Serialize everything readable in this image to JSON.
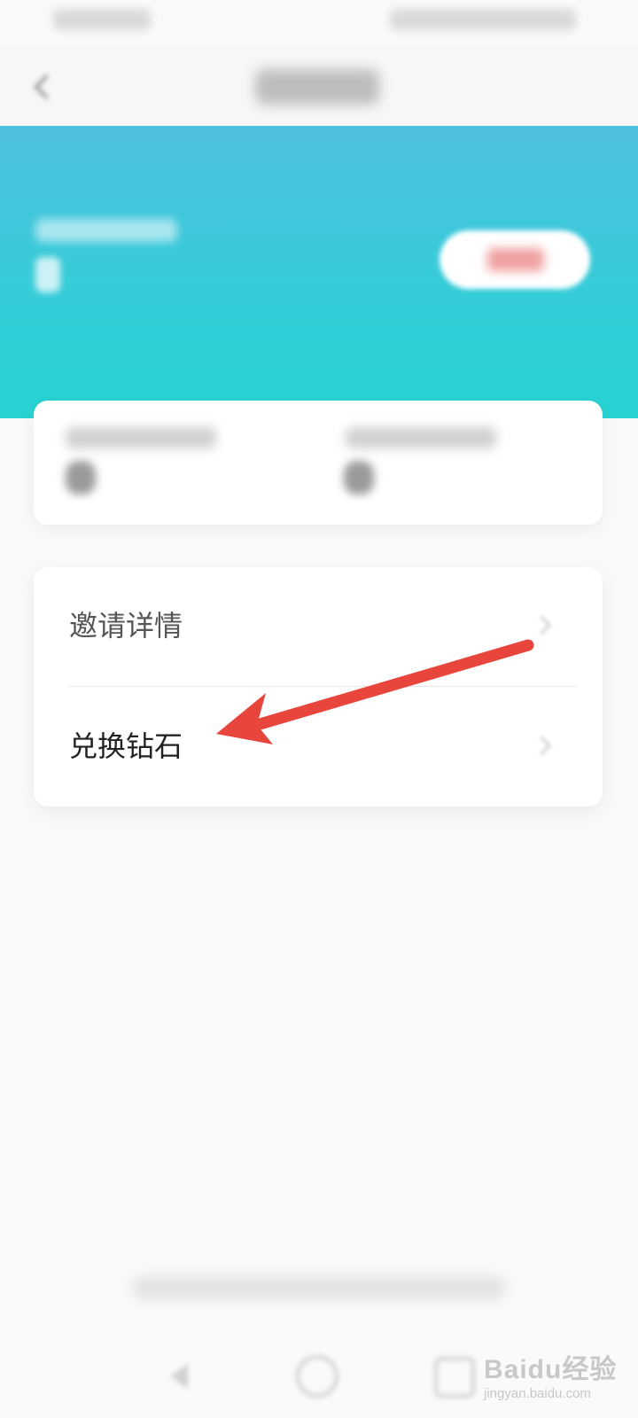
{
  "menu": {
    "items": [
      {
        "label": "邀请详情"
      },
      {
        "label": "兑换钻石"
      }
    ]
  },
  "watermark": {
    "main": "Baidu经验",
    "sub": "jingyan.baidu.com"
  },
  "colors": {
    "banner_top": "#4fc0e0",
    "banner_bottom": "#28d3d2",
    "annotation_arrow": "#e8453c"
  },
  "icons": [
    "back-icon",
    "chevron-right-icon",
    "nav-back-icon",
    "nav-home-icon",
    "nav-recents-icon"
  ]
}
